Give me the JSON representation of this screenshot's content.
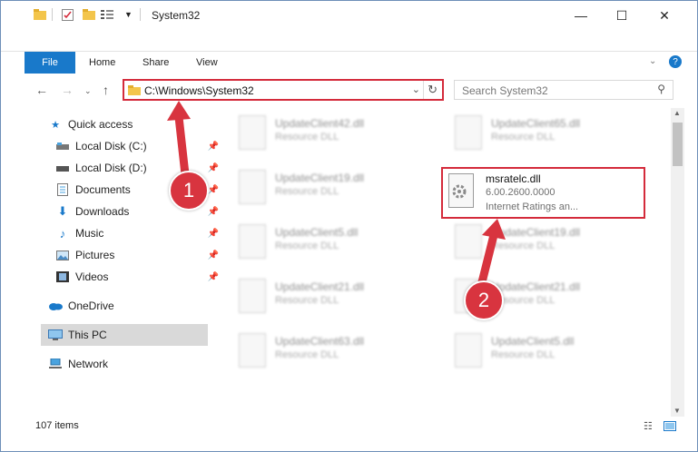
{
  "window": {
    "title": "System32",
    "buttons": {
      "minimize": "—",
      "maximize": "☐",
      "close": "✕"
    }
  },
  "ribbon": {
    "tabs": [
      "File",
      "Home",
      "Share",
      "View"
    ]
  },
  "nav": {
    "address": "C:\\Windows\\System32",
    "search_placeholder": "Search System32"
  },
  "sidebar": {
    "items": [
      {
        "label": "Quick access",
        "icon": "star-icon"
      },
      {
        "label": "Local Disk (C:)",
        "icon": "drive-icon"
      },
      {
        "label": "Local Disk (D:)",
        "icon": "drive-icon"
      },
      {
        "label": "Documents",
        "icon": "document-icon"
      },
      {
        "label": "Downloads",
        "icon": "download-icon"
      },
      {
        "label": "Music",
        "icon": "music-icon"
      },
      {
        "label": "Pictures",
        "icon": "picture-icon"
      },
      {
        "label": "Videos",
        "icon": "video-icon"
      },
      {
        "label": "OneDrive",
        "icon": "cloud-icon"
      },
      {
        "label": "This PC",
        "icon": "computer-icon"
      },
      {
        "label": "Network",
        "icon": "network-icon"
      }
    ]
  },
  "files": [
    {
      "name": "UpdateClient42.dll",
      "desc": "Resource DLL"
    },
    {
      "name": "UpdateClient65.dll",
      "desc": "Resource DLL"
    },
    {
      "name": "UpdateClient19.dll",
      "desc": "Resource DLL"
    },
    {
      "name": "UpdateClient5.dll",
      "desc": "Resource DLL"
    },
    {
      "name": "UpdateClient19.dll",
      "desc": "Resource DLL"
    },
    {
      "name": "UpdateClient21.dll",
      "desc": "Resource DLL"
    },
    {
      "name": "UpdateClient21.dll",
      "desc": "Resource DLL"
    },
    {
      "name": "UpdateClient63.dll",
      "desc": "Resource DLL"
    },
    {
      "name": "UpdateClient5.dll",
      "desc": "Resource DLL"
    }
  ],
  "highlight_file": {
    "name": "msratelc.dll",
    "version": "6.00.2600.0000",
    "desc": "Internet Ratings an..."
  },
  "status": {
    "count": "107 items"
  },
  "annotations": {
    "step1": "1",
    "step2": "2",
    "color": "#d8343f"
  }
}
